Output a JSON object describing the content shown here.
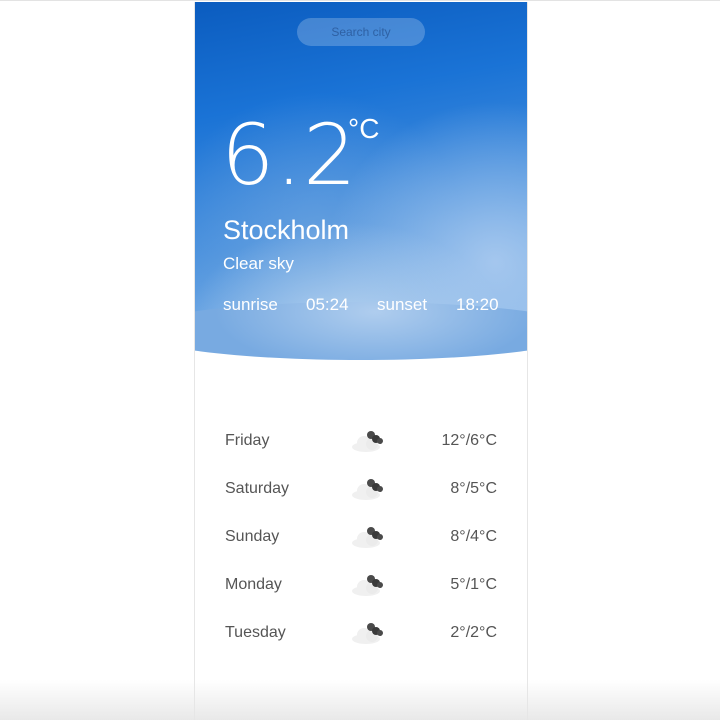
{
  "search": {
    "placeholder": "Search city"
  },
  "current": {
    "temperature": "6.2",
    "unit": "°C",
    "city": "Stockholm",
    "condition": "Clear sky",
    "sunrise_label": "sunrise",
    "sunrise_time": "05:24",
    "sunset_label": "sunset",
    "sunset_time": "18:20"
  },
  "forecast": [
    {
      "day": "Friday",
      "icon": "cloud-icon",
      "temps": "12°/6°C"
    },
    {
      "day": "Saturday",
      "icon": "cloud-icon",
      "temps": "8°/5°C"
    },
    {
      "day": "Sunday",
      "icon": "cloud-icon",
      "temps": "8°/4°C"
    },
    {
      "day": "Monday",
      "icon": "cloud-icon",
      "temps": "5°/1°C"
    },
    {
      "day": "Tuesday",
      "icon": "cloud-icon",
      "temps": "2°/2°C"
    }
  ],
  "colors": {
    "hero_top": "#0b5cbf",
    "hero_bottom": "#8ab8e8",
    "text_light": "#ffffff",
    "text_dark": "#555555"
  }
}
